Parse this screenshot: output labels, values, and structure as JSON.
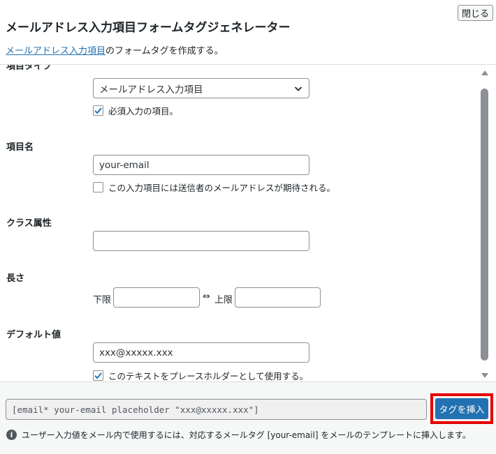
{
  "header": {
    "close_label": "閉じる",
    "title": "メールアドレス入力項目フォームタグジェネレーター",
    "desc_link": "メールアドレス入力項目",
    "desc_text": "のフォームタグを作成する。"
  },
  "form": {
    "type_label": "項目タイプ",
    "type_value": "メールアドレス入力項目",
    "required_label": "必須入力の項目。",
    "required_checked": true,
    "name_label": "項目名",
    "name_value": "your-email",
    "sender_label": "この入力項目には送信者のメールアドレスが期待される。",
    "sender_checked": false,
    "class_label": "クラス属性",
    "class_value": "",
    "length_label": "長さ",
    "min_label": "下限",
    "range_arrow": "⇔",
    "max_label": "上限",
    "min_value": "",
    "max_value": "",
    "default_label": "デフォルト値",
    "default_value": "xxx@xxxxx.xxx",
    "placeholder_label": "このテキストをプレースホルダーとして使用する。",
    "placeholder_checked": true
  },
  "footer": {
    "tag_value": "[email* your-email placeholder \"xxx@xxxxx.xxx\"]",
    "insert_label": "タグを挿入",
    "info_text": "ユーザー入力値をメール内で使用するには、対応するメールタグ [your-email] をメールのテンプレートに挿入します。"
  },
  "colors": {
    "accent": "#2271b1",
    "highlight": "#e60000",
    "footer_bg": "#f6f7f7"
  },
  "icons": [
    "chevron-down-icon",
    "checkmark-icon",
    "info-icon",
    "scroll-up-arrow-icon",
    "scroll-down-arrow-icon"
  ]
}
